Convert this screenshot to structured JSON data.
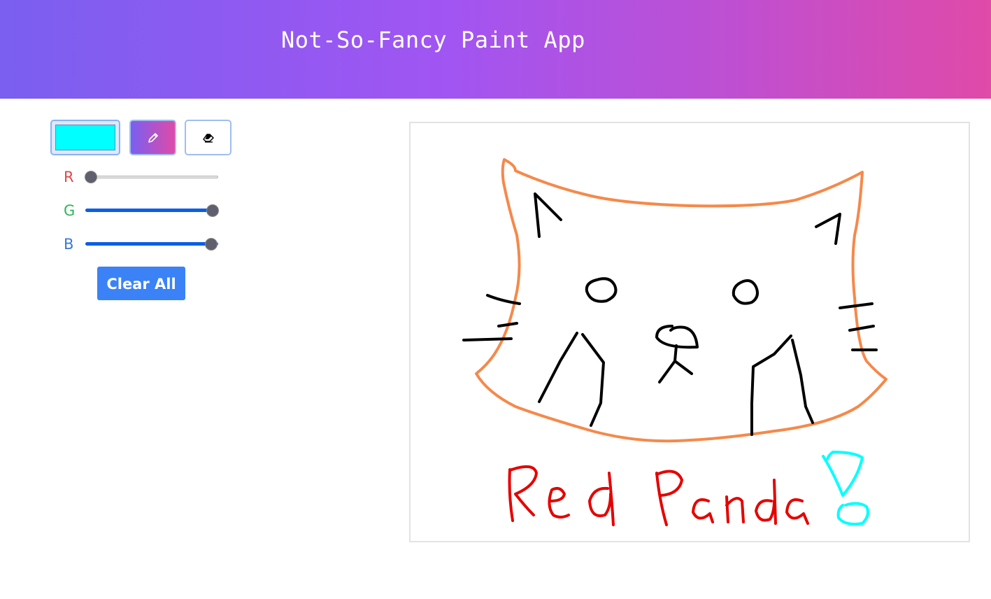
{
  "app": {
    "title": "Not-So-Fancy Paint App"
  },
  "toolbar": {
    "current_color": "#00ffff",
    "tools": [
      {
        "name": "color-picker",
        "icon": "color-swatch"
      },
      {
        "name": "pencil",
        "icon": "pencil-icon",
        "selected": true
      },
      {
        "name": "eraser",
        "icon": "eraser-icon",
        "selected": false
      }
    ]
  },
  "sliders": {
    "r": {
      "label": "R",
      "value": 0,
      "max": 255,
      "color": "#e04848"
    },
    "g": {
      "label": "G",
      "value": 255,
      "max": 255,
      "color": "#2fb55a"
    },
    "b": {
      "label": "B",
      "value": 255,
      "max": 255,
      "color": "#3b78d8"
    }
  },
  "actions": {
    "clear_label": "Clear All"
  },
  "drawing": {
    "handwritten_text": "Red Panda",
    "stroke_colors": [
      "#f5894a",
      "#000000",
      "#e60000",
      "#00ffff"
    ]
  }
}
